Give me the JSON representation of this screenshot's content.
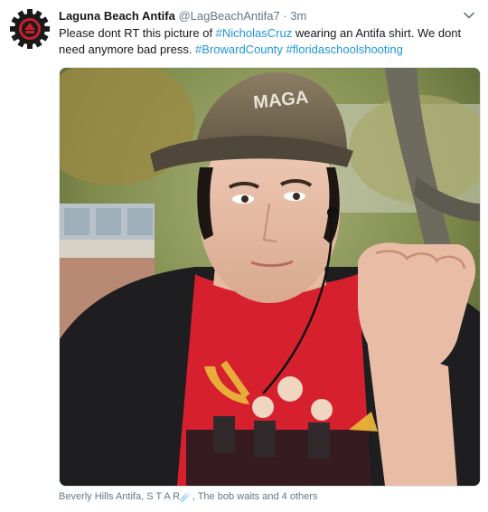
{
  "tweet": {
    "display_name": "Laguna Beach Antifa",
    "handle": "@LagBeachAntifa7",
    "separator": "·",
    "time": "3m",
    "text": {
      "part1": "Please dont RT this picture of ",
      "hashtag1": "#NicholasCruz",
      "part2": " wearing an Antifa shirt. We dont need anymore bad press. ",
      "hashtag2": "#BrowardCounty",
      "space": " ",
      "hashtag3": "#floridaschoolshooting"
    },
    "likers": "Beverly Hills Antifa, S T A R☄️, The bob waits and 4 others",
    "cap_text": "MAGA",
    "icons": {
      "avatar": "antifa-gear-logo",
      "chevron": "chevron-down-icon"
    },
    "colors": {
      "link": "#1b95e0",
      "secondary": "#657786",
      "shirt": "#d6202e"
    }
  }
}
